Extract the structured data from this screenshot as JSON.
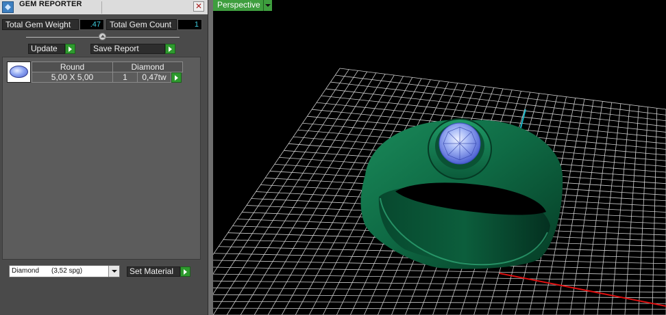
{
  "panel": {
    "title": "GEM REPORTER",
    "close_symbol": "✕",
    "total_weight_label": "Total Gem Weight",
    "total_weight_value": ".47",
    "total_count_label": "Total Gem Count",
    "total_count_value": "1",
    "update_label": "Update",
    "save_report_label": "Save Report"
  },
  "gem_table": {
    "headers": [
      "Round",
      "Diamond"
    ],
    "row": {
      "size": "5,00 X 5,00",
      "count": "1",
      "weight": "0,47tw"
    }
  },
  "material": {
    "name": "Diamond",
    "sg": "(3,52 spg)",
    "set_label": "Set Material"
  },
  "viewport": {
    "view_label": "Perspective"
  },
  "colors": {
    "ring": "#0f6b45",
    "gem": "#8fa6f2",
    "grid": "#cfcfcf",
    "axis_x": "#e01010",
    "axis_z": "#19b8c8",
    "accent_green": "#3e9e3e"
  }
}
